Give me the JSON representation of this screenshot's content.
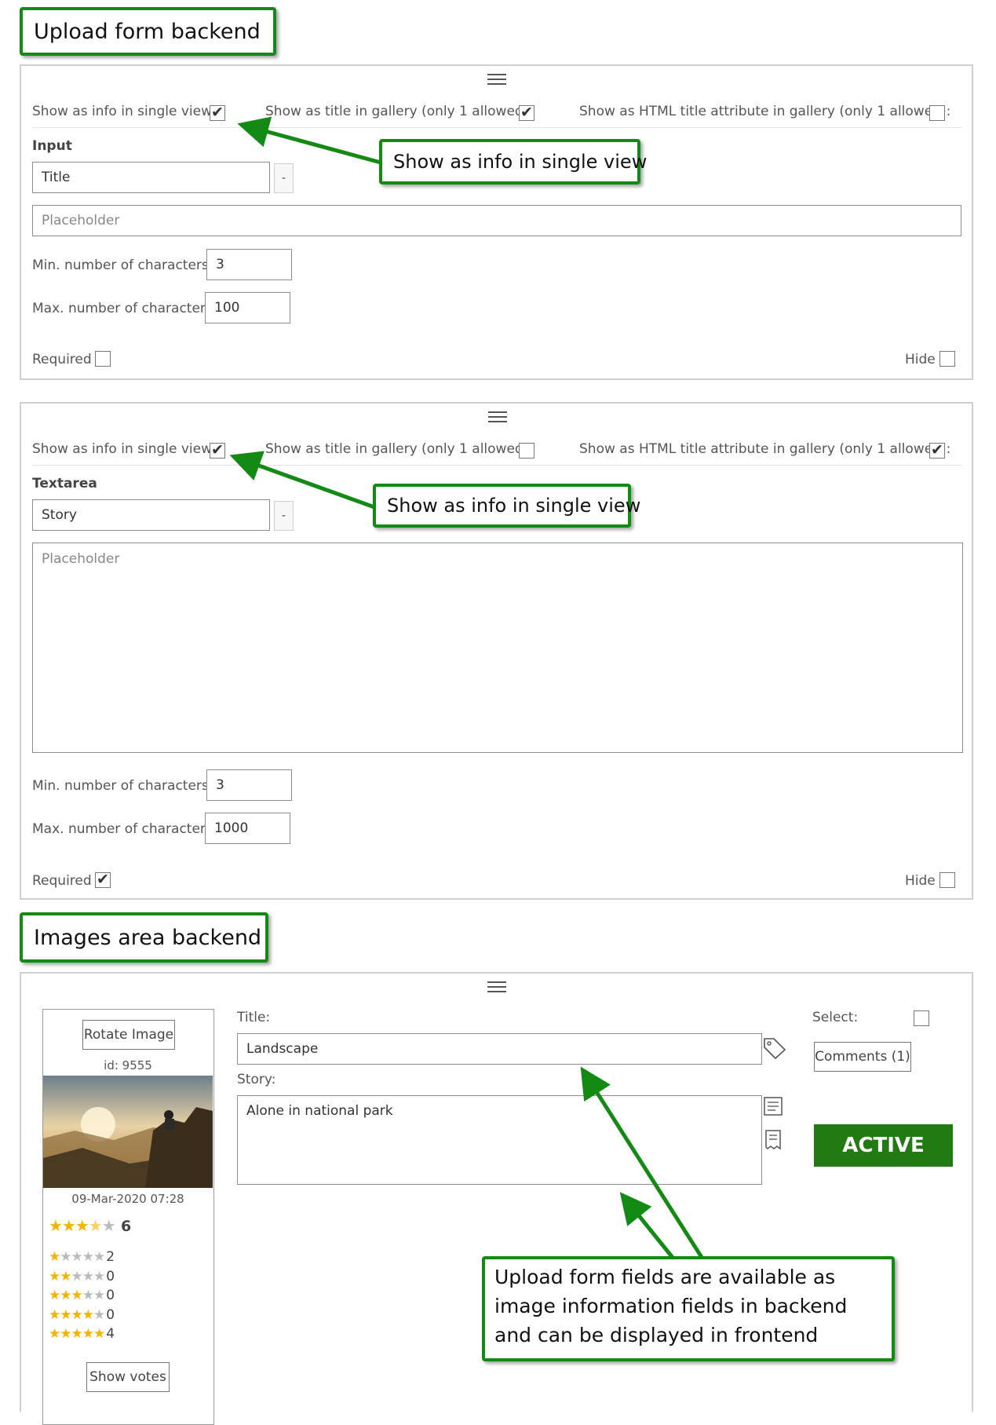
{
  "labels": {
    "upload_form_backend": "Upload form backend",
    "images_area_backend": "Images area backend",
    "callout_single_view": "Show as info in single view",
    "callout_fields": "Upload form fields are available as image information fields in backend and can be displayed in frontend"
  },
  "panel_input": {
    "show_info_single": "Show as info in single view:",
    "show_title_gallery": "Show as title in gallery (only 1 allowed):",
    "show_html_title": "Show as HTML title attribute in gallery (only 1 allowed):",
    "type": "Input",
    "name_value": "Title",
    "minus": "-",
    "placeholder": "Placeholder",
    "min_label": "Min. number of characters:",
    "min_value": "3",
    "max_label": "Max. number of characters:",
    "max_value": "100",
    "required": "Required",
    "hide": "Hide"
  },
  "panel_textarea": {
    "show_info_single": "Show as info in single view:",
    "show_title_gallery": "Show as title in gallery (only 1 allowed):",
    "show_html_title": "Show as HTML title attribute in gallery (only 1 allowed):",
    "type": "Textarea",
    "name_value": "Story",
    "minus": "-",
    "placeholder": "Placeholder",
    "min_label": "Min. number of characters:",
    "min_value": "3",
    "max_label": "Max. number of characters:",
    "max_value": "1000",
    "required": "Required",
    "hide": "Hide"
  },
  "images_panel": {
    "rotate": "Rotate Image",
    "id": "id: 9555",
    "date": "09-Mar-2020 07:28",
    "rating_total": "6",
    "rating_rows": [
      "2",
      "0",
      "0",
      "0",
      "4"
    ],
    "show_votes": "Show votes",
    "title_label": "Title:",
    "title_value": "Landscape",
    "story_label": "Story:",
    "story_value": "Alone in national park",
    "select_label": "Select:",
    "comments": "Comments (1)",
    "active": "ACTIVE"
  },
  "colors": {
    "accent_green": "#138a13",
    "active_green": "#217a12",
    "star": "#f5b400"
  }
}
